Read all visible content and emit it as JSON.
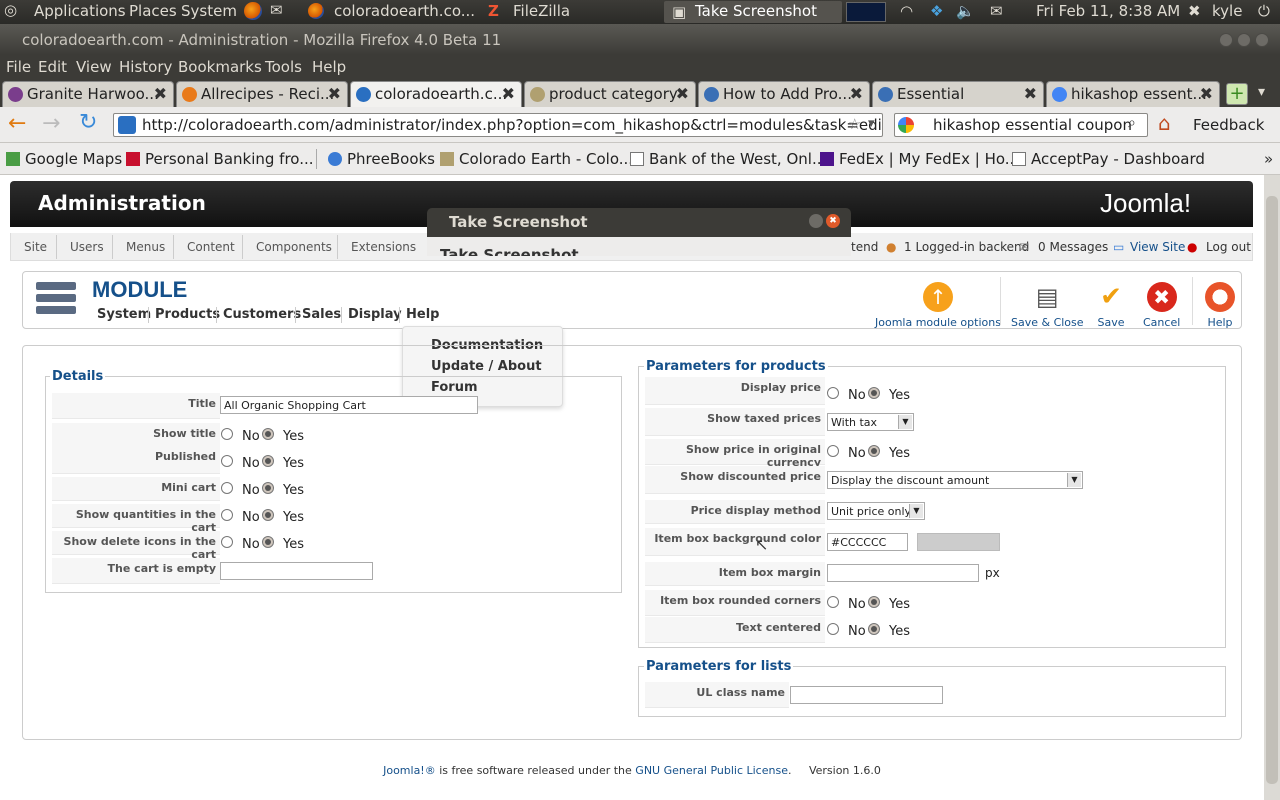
{
  "top_panel": {
    "applications": "Applications",
    "places": "Places",
    "system": "System",
    "task_firefox": "coloradoearth.co...",
    "task_filezilla": "FileZilla",
    "task_screenshot": "Take Screenshot",
    "clock": "Fri Feb 11,  8:38 AM",
    "user": "kyle"
  },
  "window": {
    "title": "coloradoearth.com - Administration - Mozilla Firefox 4.0 Beta 11"
  },
  "menubar": {
    "file": "File",
    "edit": "Edit",
    "view": "View",
    "history": "History",
    "bookmarks": "Bookmarks",
    "tools": "Tools",
    "help": "Help"
  },
  "tabs": [
    {
      "label": "Granite Harwoo...",
      "icon_color": "#7a3d8c"
    },
    {
      "label": "Allrecipes - Reci...",
      "icon_color": "#e97a1a"
    },
    {
      "label": "coloradoearth.c...",
      "icon_color": "#2a6fc1"
    },
    {
      "label": "product category",
      "icon_color": "#b0a070"
    },
    {
      "label": "How to Add Pro...",
      "icon_color": "#3a6fb5"
    },
    {
      "label": "Essential",
      "icon_color": "#3a6fb5"
    },
    {
      "label": "hikashop essent...",
      "icon_color": "#4285f4"
    }
  ],
  "nav": {
    "url": "http://coloradoearth.com/administrator/index.php?option=com_hikashop&ctrl=modules&task=edit&cid",
    "search": "hikashop essential coupon",
    "feedback": "Feedback"
  },
  "bookmarks": [
    {
      "label": "Google Maps",
      "color": "#4a9d45"
    },
    {
      "label": "Personal Banking fro...",
      "color": "#c8102e"
    },
    {
      "label": "PhreeBooks",
      "color": "#3a7bd5"
    },
    {
      "label": "Colorado Earth - Colo...",
      "color": "#b0a070"
    },
    {
      "label": "Bank of the West, Onl...",
      "color": "#ffffff"
    },
    {
      "label": "FedEx | My FedEx | Ho...",
      "color": "#4d148c"
    },
    {
      "label": "AcceptPay - Dashboard",
      "color": "#ffffff"
    }
  ],
  "admin": {
    "title": "Administration",
    "logo": "Joomla!",
    "menu": [
      "Site",
      "Users",
      "Menus",
      "Content",
      "Components",
      "Extensions"
    ],
    "status_frontend": "tend",
    "status_backend": "1 Logged-in backend",
    "status_messages": "0 Messages",
    "view_site": "View Site",
    "logout": "Log out"
  },
  "module": {
    "title": "MODULE",
    "submenu": [
      "System",
      "Products",
      "Customers",
      "Sales",
      "Display",
      "Help"
    ],
    "help_items": [
      "Documentation",
      "Update / About",
      "Forum"
    ],
    "toolbar": {
      "options": "Joomla module options",
      "save_close": "Save & Close",
      "save": "Save",
      "cancel": "Cancel",
      "help": "Help"
    }
  },
  "details": {
    "legend": "Details",
    "title_label": "Title",
    "title_value": "All Organic Shopping Cart",
    "show_title": "Show title",
    "published": "Published",
    "mini_cart": "Mini cart",
    "show_quantities": "Show quantities in the cart",
    "show_delete": "Show delete icons in the cart",
    "cart_empty": "The cart is empty",
    "no": "No",
    "yes": "Yes"
  },
  "products": {
    "legend": "Parameters for products",
    "display_price": "Display price",
    "show_taxed": "Show taxed prices",
    "taxed_value": "With tax",
    "show_original": "Show price in original currency",
    "show_discounted": "Show discounted price",
    "discounted_value": "Display the discount amount",
    "price_method": "Price display method",
    "price_method_value": "Unit price only",
    "bg_color": "Item box background color",
    "bg_color_value": "#CCCCCC",
    "swatch_color": "#cccccc",
    "margin": "Item box margin",
    "px": "px",
    "rounded": "Item box rounded corners",
    "centered": "Text centered"
  },
  "lists": {
    "legend": "Parameters for lists",
    "ul_class": "UL class name"
  },
  "footer": {
    "joomla": "Joomla!®",
    "text1": " is free software released under the ",
    "license": "GNU General Public License",
    "version": ".     Version 1.6.0"
  },
  "dialog": {
    "title": "Take Screenshot",
    "body_title": "Take Screenshot"
  }
}
